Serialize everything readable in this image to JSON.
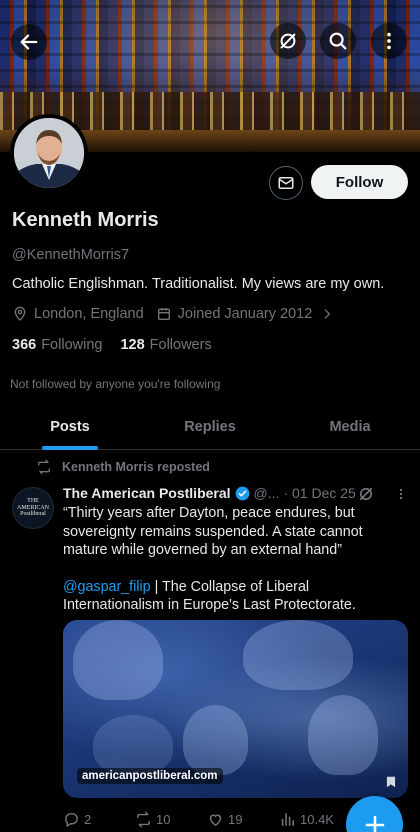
{
  "header": {
    "back_icon": "arrow-left-icon",
    "grok_icon": "grok-icon",
    "search_icon": "search-icon",
    "more_icon": "more-vertical-icon"
  },
  "profile": {
    "name": "Kenneth Morris",
    "handle": "@KennethMorris7",
    "bio": "Catholic Englishman. Traditionalist. My views are my own.",
    "location": "London, England",
    "joined": "Joined January 2012",
    "following_count": "366",
    "following_label": "Following",
    "followers_count": "128",
    "followers_label": "Followers",
    "not_followed_text": "Not followed by anyone you're following",
    "follow_label": "Follow"
  },
  "tabs": [
    {
      "label": "Posts",
      "active": true
    },
    {
      "label": "Replies",
      "active": false
    },
    {
      "label": "Media",
      "active": false
    }
  ],
  "post": {
    "repost_label": "Kenneth Morris reposted",
    "author": "The American Postliberal",
    "author_handle": "@...",
    "date": "· 01 Dec 25",
    "avatar_text": "THE AMERICAN Postliberal",
    "text_main": "“Thirty years after Dayton, peace endures, but sovereignty remains suspended. A state cannot mature while governed by an external hand”",
    "mention": "@gaspar_filip",
    "text_link": " | The Collapse of Liberal Internationalism in Europe's Last Protectorate.",
    "media_caption": "americanpostliberal.com",
    "replies": "2",
    "reposts": "10",
    "likes": "19",
    "views": "10.4K"
  },
  "colors": {
    "accent": "#1d9bf0",
    "background": "#000000",
    "muted": "#71767b"
  }
}
